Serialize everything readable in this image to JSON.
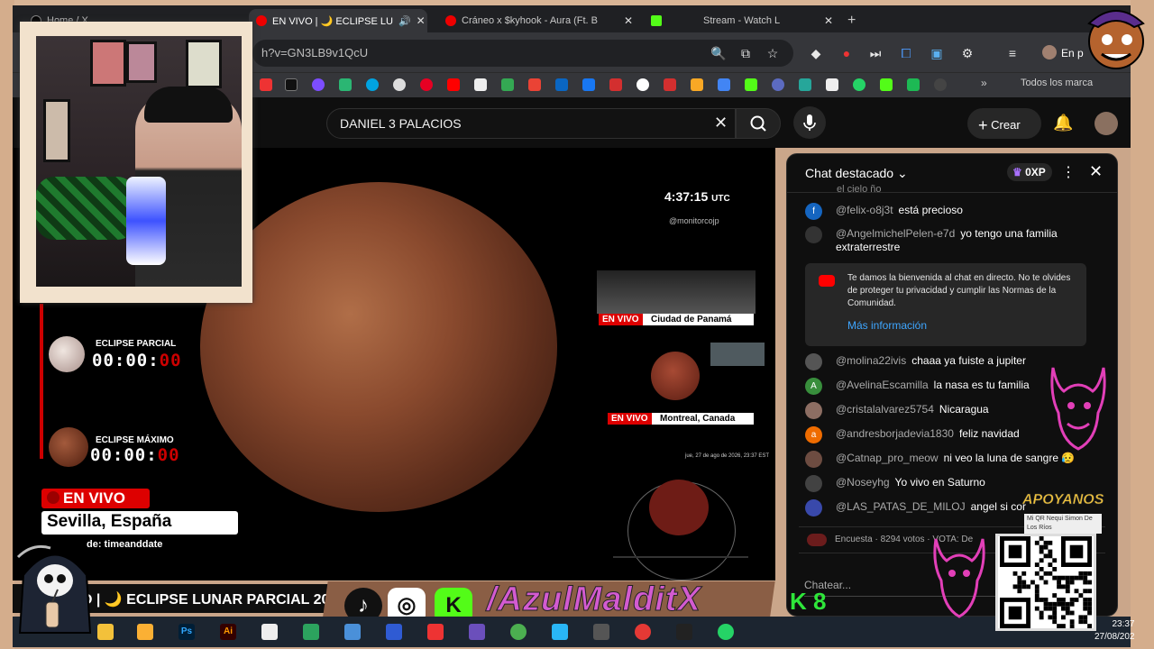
{
  "browser": {
    "tabs": [
      {
        "label": "Home / X"
      },
      {
        "label": "EN VIVO | 🌙 ECLIPSE LU"
      },
      {
        "label": "Cráneo x $kyhook - Aura (Ft. B"
      },
      {
        "label": "Stream - Watch L"
      }
    ],
    "new_tab": "+",
    "url": "h?v=GN3LB9v1QcU",
    "bookmarks_all": "Todos los marca",
    "profile_label": "En p"
  },
  "youtube": {
    "search_value": "DANIEL 3 PALACIOS",
    "crear_label": "Crear"
  },
  "video": {
    "time": "4:37:15",
    "time_zone": "UTC",
    "handle": "@monitorcojp",
    "panama_live": "EN VIVO",
    "panama_city": "Ciudad de Panamá",
    "montreal_live": "EN VIVO",
    "montreal_city": "Montreal, Canada",
    "small_date": "jue, 27 de ago de 2026, 23:37 EST",
    "eclipse_partial_label": "ECLIPSE PARCIAL",
    "eclipse_partial_time": "00:00:",
    "eclipse_partial_sec": "00",
    "eclipse_max_label": "ECLIPSE MÁXIMO",
    "eclipse_max_time": "00:00:",
    "eclipse_max_sec": "00",
    "live_badge": "EN VIVO",
    "location": "Sevilla, España",
    "source": "de: timeanddate",
    "banner": "O | 🌙 ECLIPSE LUNAR PARCIAL 20"
  },
  "chat": {
    "title": "Chat destacado",
    "xp": "0XP",
    "partial_top": "el cielo ño",
    "messages": [
      {
        "author": "@felix-o8j3t",
        "text": "está precioso",
        "avatar": "f",
        "color": "#1565c0"
      },
      {
        "author": "@AngelmichelPelen-e7d",
        "text": "yo tengo una familia extraterrestre",
        "avatar": "",
        "color": "#333333"
      },
      {
        "author": "@molina22ivis",
        "text": "chaaa ya fuiste a jupiter",
        "avatar": "",
        "color": "#555555"
      },
      {
        "author": "@AvelinaEscamilla",
        "text": "la nasa es tu familia",
        "avatar": "A",
        "color": "#388e3c"
      },
      {
        "author": "@cristalalvarez5754",
        "text": "Nicaragua",
        "avatar": "",
        "color": "#8d6e63"
      },
      {
        "author": "@andresborjadevia1830",
        "text": "feliz navidad",
        "avatar": "a",
        "color": "#ef6c00"
      },
      {
        "author": "@Catnap_pro_meow",
        "text": "ni veo la luna de sangre 😥",
        "avatar": "",
        "color": "#6d4c41"
      },
      {
        "author": "@Noseyhg",
        "text": "Yo vivo en Saturno",
        "avatar": "",
        "color": "#424242"
      },
      {
        "author": "@LAS_PATAS_DE_MILOJ",
        "text": "angel si cor",
        "avatar": "",
        "color": "#3949ab"
      }
    ],
    "welcome": "Te damos la bienvenida al chat en directo. No te olvides de proteger tu privacidad y cumplir las Normas de la Comunidad.",
    "welcome_link": "Más información",
    "poll": "Encuesta · 8294 votos · VOTA: De",
    "input_placeholder": "Chatear..."
  },
  "overlay": {
    "handle": "/AzulMalditX",
    "k8": "K 8",
    "apoyanos": "APOYANOS",
    "qr_note": "Mi QR Nequi Simon De Los Ríos",
    "tiktok": "♪",
    "instagram": "◎",
    "kick": "K"
  },
  "taskbar": {
    "time": "23:37",
    "date": "27/08/202"
  }
}
